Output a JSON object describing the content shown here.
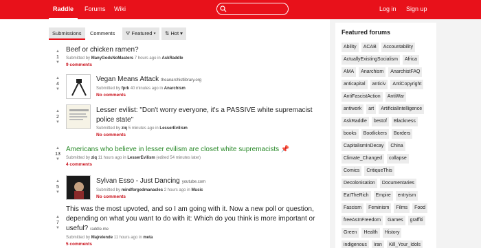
{
  "header": {
    "brand": "Raddle",
    "nav": [
      "Forums",
      "Wiki"
    ],
    "login": "Log in",
    "signup": "Sign up",
    "search_placeholder": ""
  },
  "toolbar": {
    "tabs": [
      "Submissions",
      "Comments"
    ],
    "filter_featured": "Featured",
    "sort_hot": "Hot"
  },
  "posts": [
    {
      "score": "1",
      "title": "Beef or chicken ramen?",
      "domain": "",
      "submitted_prefix": "Submitted by",
      "author": "ManyGodsNoMasters",
      "time": "7 hours ago in",
      "forum": "AskRaddle",
      "extra": "",
      "comments": "9 comments"
    },
    {
      "score": "4",
      "title": "Vegan Means Attack",
      "domain": "theanarchistlibrary.org",
      "submitted_prefix": "Submitted by",
      "author": "fprk",
      "time": "40 minutes ago in",
      "forum": "Anarchism",
      "extra": "",
      "comments": "No comments"
    },
    {
      "score": "2",
      "title": "Lesser evilist: \"Don't worry everyone, it's a PASSIVE white supremacist police state\"",
      "domain": "",
      "submitted_prefix": "Submitted by",
      "author": "ziq",
      "time": "5 minutes ago in",
      "forum": "LesserEvilism",
      "extra": "",
      "comments": "No comments"
    },
    {
      "score": "13",
      "title": "Americans who believe in lesser evilism are closet white supremacists",
      "domain": "",
      "submitted_prefix": "Submitted by",
      "author": "ziq",
      "time": "11 hours ago in",
      "forum": "LesserEvilism",
      "extra": "(edited 54 minutes later)",
      "comments": "4 comments"
    },
    {
      "score": "5",
      "title": "Sylvan Esso - Just Dancing",
      "domain": "youtube.com",
      "submitted_prefix": "Submitted by",
      "author": "mindforgedmanacles",
      "time": "2 hours ago in",
      "forum": "Music",
      "extra": "",
      "comments": "No comments"
    },
    {
      "score": "7",
      "title": "This was the most upvoted, and so I am going with it. Now a new poll or question, depending on what you want to do with it: Which do you think is more important or useful?",
      "domain": "raddle.me",
      "submitted_prefix": "Submitted by",
      "author": "Majrelende",
      "time": "11 hours ago in",
      "forum": "meta",
      "extra": "",
      "comments": "5 comments"
    }
  ],
  "sidebar": {
    "title": "Featured forums",
    "forums": [
      "Ability",
      "ACAB",
      "Accountability",
      "ActuallyExistingSocialism",
      "Africa",
      "AMA",
      "Anarchism",
      "AnarchistFAQ",
      "anticapital",
      "anticiv",
      "AntiCopyright",
      "AntiFascistAction",
      "AntiWar",
      "antiwork",
      "art",
      "ArtificialIntelligence",
      "AskRaddle",
      "bestof",
      "Blackness",
      "books",
      "Bootlickers",
      "Borders",
      "CapitalismInDecay",
      "China",
      "Climate_Changed",
      "collapse",
      "Comics",
      "CritiqueThis",
      "Decolonisation",
      "Documentaries",
      "EatTheRich",
      "Empire",
      "entryism",
      "Fascism",
      "Feminism",
      "Films",
      "Food",
      "freeAsInFreedom",
      "Games",
      "graffiti",
      "Green",
      "Health",
      "History",
      "indigenous",
      "Iran",
      "Kill_Your_Idols"
    ]
  },
  "colors": {
    "accent": "#e8111a",
    "green_title": "#2a8a2a"
  }
}
